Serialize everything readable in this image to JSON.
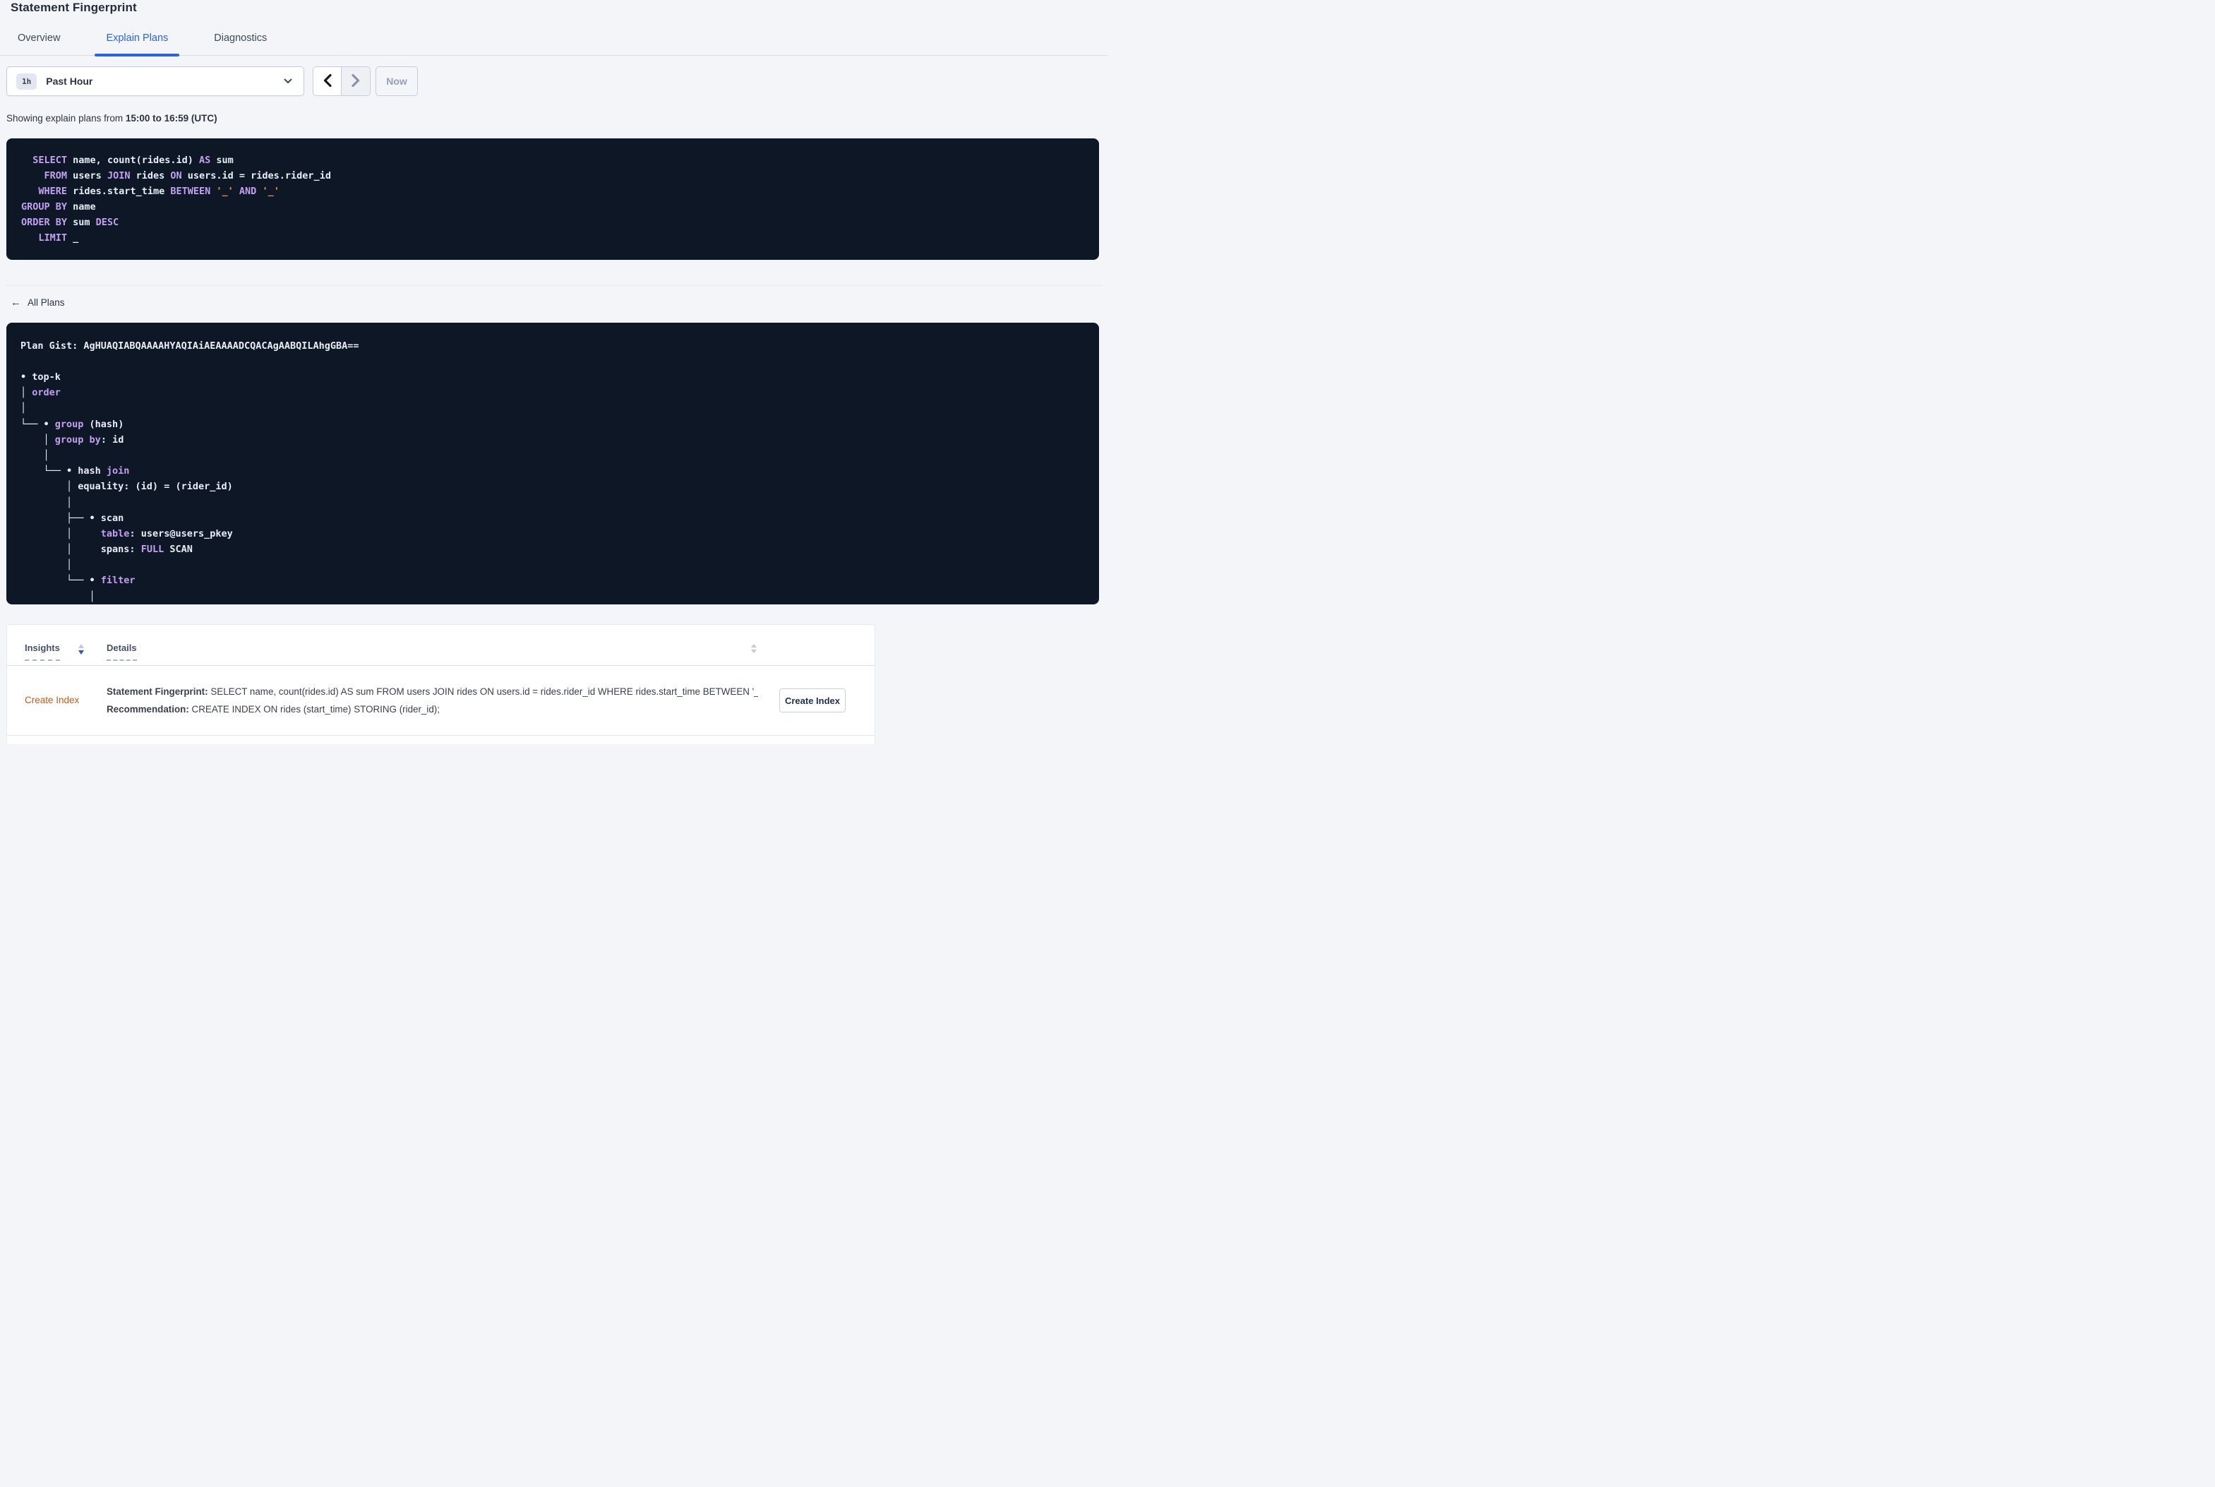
{
  "page": {
    "title": "Statement Fingerprint"
  },
  "tabs": [
    {
      "label": "Overview",
      "active": false
    },
    {
      "label": "Explain Plans",
      "active": true
    },
    {
      "label": "Diagnostics",
      "active": false
    }
  ],
  "time_controls": {
    "range_badge": "1h",
    "range_label": "Past Hour",
    "now_label": "Now"
  },
  "showing": {
    "prefix": "Showing explain plans from ",
    "range": "15:00 to 16:59 (UTC)"
  },
  "sql_box": {
    "lines": [
      [
        {
          "t": "  ",
          "c": "p"
        },
        {
          "t": "SELECT",
          "c": "k"
        },
        {
          "t": " name, count(rides.id) ",
          "c": "p"
        },
        {
          "t": "AS",
          "c": "k"
        },
        {
          "t": " sum",
          "c": "p"
        }
      ],
      [
        {
          "t": "    ",
          "c": "p"
        },
        {
          "t": "FROM",
          "c": "k"
        },
        {
          "t": " users ",
          "c": "p"
        },
        {
          "t": "JOIN",
          "c": "k"
        },
        {
          "t": " rides ",
          "c": "p"
        },
        {
          "t": "ON",
          "c": "k"
        },
        {
          "t": " users.id = rides.rider_id",
          "c": "p"
        }
      ],
      [
        {
          "t": "   ",
          "c": "p"
        },
        {
          "t": "WHERE",
          "c": "k"
        },
        {
          "t": " rides.start_time ",
          "c": "p"
        },
        {
          "t": "BETWEEN",
          "c": "k"
        },
        {
          "t": " ",
          "c": "p"
        },
        {
          "t": "'_'",
          "c": "s"
        },
        {
          "t": " ",
          "c": "p"
        },
        {
          "t": "AND",
          "c": "k"
        },
        {
          "t": " ",
          "c": "p"
        },
        {
          "t": "'_'",
          "c": "s"
        }
      ],
      [
        {
          "t": "GROUP BY",
          "c": "k"
        },
        {
          "t": " name",
          "c": "p"
        }
      ],
      [
        {
          "t": "ORDER BY",
          "c": "k"
        },
        {
          "t": " sum ",
          "c": "p"
        },
        {
          "t": "DESC",
          "c": "k"
        }
      ],
      [
        {
          "t": "   ",
          "c": "p"
        },
        {
          "t": "LIMIT",
          "c": "k"
        },
        {
          "t": " _",
          "c": "p"
        }
      ]
    ]
  },
  "all_plans": {
    "label": "All Plans",
    "icon": "back-arrow"
  },
  "plan": {
    "gist_line": "Plan Gist: AgHUAQIABQAAAAHYAQIAiAEAAAADCQACAgAABQILAhgGBA==",
    "tree_lines": [
      [
        {
          "t": "• top-k",
          "c": "p"
        }
      ],
      [
        {
          "t": "│ ",
          "c": "p"
        },
        {
          "t": "order",
          "c": "k"
        }
      ],
      [
        {
          "t": "│",
          "c": "p"
        }
      ],
      [
        {
          "t": "└── • ",
          "c": "p"
        },
        {
          "t": "group",
          "c": "k"
        },
        {
          "t": " (hash)",
          "c": "p"
        }
      ],
      [
        {
          "t": "    │ ",
          "c": "p"
        },
        {
          "t": "group by",
          "c": "k"
        },
        {
          "t": ": id",
          "c": "p"
        }
      ],
      [
        {
          "t": "    │",
          "c": "p"
        }
      ],
      [
        {
          "t": "    └── • hash ",
          "c": "p"
        },
        {
          "t": "join",
          "c": "k"
        }
      ],
      [
        {
          "t": "        │ equality: (id) = (rider_id)",
          "c": "p"
        }
      ],
      [
        {
          "t": "        │",
          "c": "p"
        }
      ],
      [
        {
          "t": "        ├── • scan",
          "c": "p"
        }
      ],
      [
        {
          "t": "        │     ",
          "c": "p"
        },
        {
          "t": "table",
          "c": "k"
        },
        {
          "t": ": users@users_pkey",
          "c": "p"
        }
      ],
      [
        {
          "t": "        │     spans: ",
          "c": "p"
        },
        {
          "t": "FULL",
          "c": "k"
        },
        {
          "t": " SCAN",
          "c": "p"
        }
      ],
      [
        {
          "t": "        │",
          "c": "p"
        }
      ],
      [
        {
          "t": "        └── • ",
          "c": "p"
        },
        {
          "t": "filter",
          "c": "k"
        }
      ],
      [
        {
          "t": "            │",
          "c": "p"
        }
      ]
    ]
  },
  "insights_table": {
    "col_insights": "Insights",
    "col_details": "Details",
    "rows": [
      {
        "insight": "Create Index",
        "fingerprint_label": "Statement Fingerprint:",
        "fingerprint_value": "SELECT name, count(rides.id) AS sum FROM users JOIN rides ON users.id = rides.rider_id WHERE rides.start_time BETWEEN '_...",
        "recommendation_label": "Recommendation:",
        "recommendation_value": "CREATE INDEX ON rides (start_time) STORING (rider_id);",
        "action_label": "Create Index"
      }
    ]
  },
  "colors": {
    "accent_blue": "#2b63e8",
    "code_bg": "#0e1726",
    "code_keyword": "#c2a1f0",
    "code_string": "#e9973f",
    "code_text": "#e9edf5",
    "insight_orange": "#bf5b17",
    "page_bg": "#f4f5f9"
  }
}
